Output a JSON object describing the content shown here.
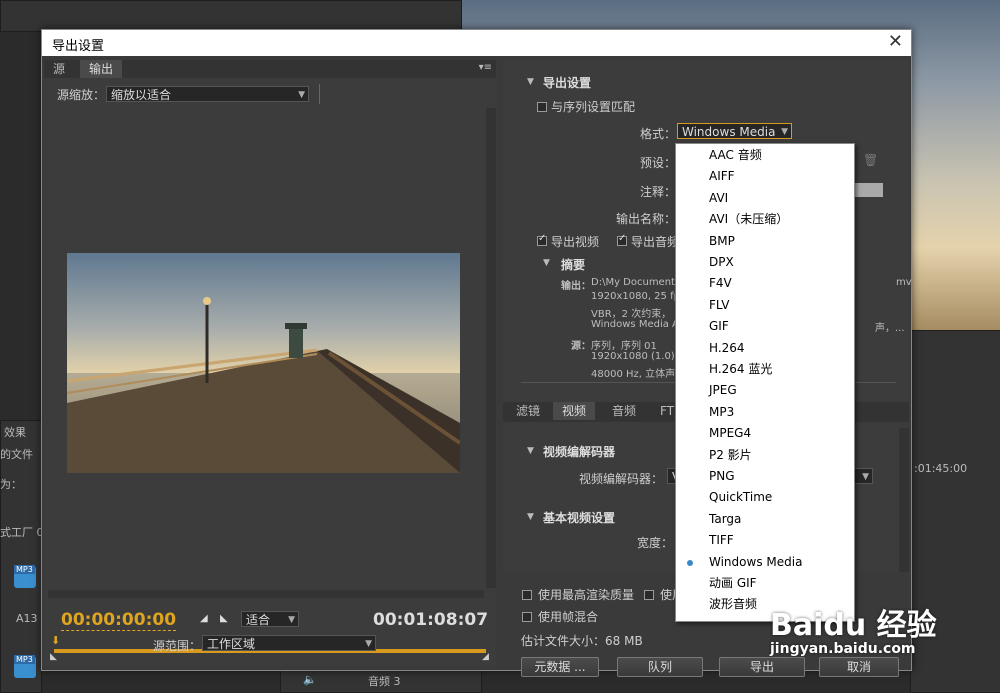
{
  "dialog": {
    "title": "导出设置",
    "close_label": "✕"
  },
  "left": {
    "tabs": [
      "源",
      "输出"
    ],
    "source_zoom_label": "源缩放：",
    "source_zoom_value": "缩放以适合",
    "timecode_current": "00:00:00:00",
    "timecode_duration": "00:01:08:07",
    "fit_value": "适合",
    "range_label": "源范围：",
    "range_value": "工作区域"
  },
  "export": {
    "section_title": "导出设置",
    "match_sequence_label": "与序列设置匹配",
    "format_label": "格式：",
    "format_value": "Windows Media",
    "preset_label": "预设：",
    "comments_label": "注释：",
    "output_name_label": "输出名称：",
    "export_video_label": "导出视频",
    "export_audio_label": "导出音频",
    "summary_title": "摘要",
    "output_label": "输出：",
    "output_lines": [
      "D:\\My Documents",
      "1920x1080, 25 fp",
      "VBR，2 次约束，",
      "Windows Media A"
    ],
    "output_right_fragments": [
      "mv",
      "声，..."
    ],
    "source_label": "源：",
    "source_lines": [
      "序列，序列 01",
      "1920x1080 (1.0),",
      "48000 Hz, 立体声"
    ]
  },
  "lower_tabs": [
    "滤镜",
    "视频",
    "音频",
    "FT"
  ],
  "video": {
    "codec_section": "视频编解码器",
    "codec_label": "视频编解码器：",
    "codec_value": "V",
    "basic_section": "基本视频设置",
    "width_label": "宽度："
  },
  "bottom": {
    "max_quality_label": "使用最高渲染质量",
    "preview_label_fragment": "使用",
    "frame_blend_label": "使用帧混合",
    "file_size_label": "估计文件大小：68 MB",
    "metadata_button": "元数据 ...",
    "queue_button": "队列",
    "export_button": "导出",
    "cancel_button": "取消"
  },
  "format_options": [
    "AAC 音频",
    "AIFF",
    "AVI",
    "AVI（未压缩）",
    "BMP",
    "DPX",
    "F4V",
    "FLV",
    "GIF",
    "H.264",
    "H.264 蓝光",
    "JPEG",
    "MP3",
    "MPEG4",
    "P2 影片",
    "PNG",
    "QuickTime",
    "Targa",
    "TIFF",
    "Windows Media",
    "动画 GIF",
    "波形音频"
  ],
  "format_selected": "Windows Media",
  "background": {
    "left_texts": [
      "效果",
      "的文件",
      "为：",
      "式工厂 0",
      "A13"
    ],
    "mp3_badge": "MP3",
    "right_timecode": ":01:45:00",
    "audio_track": "音频 3",
    "watermark_brand": "Baidu 经验",
    "watermark_url": "jingyan.baidu.com"
  },
  "colors": {
    "timecode_accent": "#e0a51f",
    "selection_dot": "#3b88c7",
    "dialog_bg": "#3a3a3a"
  }
}
